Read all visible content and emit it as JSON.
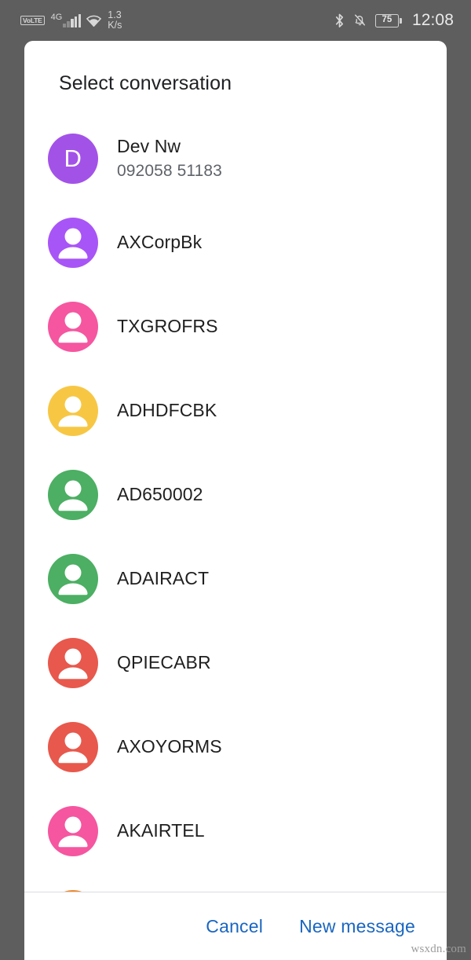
{
  "statusbar": {
    "volte_label": "VoLTE",
    "network_generation": "4G",
    "signal_icon": "signal-bars-icon",
    "wifi_icon": "wifi-icon",
    "net_speed_value": "1.3",
    "net_speed_unit": "K/s",
    "bluetooth_icon": "bluetooth-icon",
    "silent_icon": "bell-muted-icon",
    "battery_level": "75",
    "clock": "12:08"
  },
  "dialog": {
    "title": "Select conversation",
    "conversations": [
      {
        "name": "Dev Nw",
        "subtitle": "092058 51183",
        "avatar_kind": "letter",
        "avatar_letter": "D",
        "avatar_color": "#a352e8"
      },
      {
        "name": "AXCorpBk",
        "subtitle": "",
        "avatar_kind": "person",
        "avatar_letter": "",
        "avatar_color": "#a855f7"
      },
      {
        "name": "TXGROFRS",
        "subtitle": "",
        "avatar_kind": "person",
        "avatar_letter": "",
        "avatar_color": "#f5569f"
      },
      {
        "name": "ADHDFCBK",
        "subtitle": "",
        "avatar_kind": "person",
        "avatar_letter": "",
        "avatar_color": "#f7c744"
      },
      {
        "name": "AD650002",
        "subtitle": "",
        "avatar_kind": "person",
        "avatar_letter": "",
        "avatar_color": "#4caf63"
      },
      {
        "name": "ADAIRACT",
        "subtitle": "",
        "avatar_kind": "person",
        "avatar_letter": "",
        "avatar_color": "#4caf63"
      },
      {
        "name": "QPIECABR",
        "subtitle": "",
        "avatar_kind": "person",
        "avatar_letter": "",
        "avatar_color": "#e8584c"
      },
      {
        "name": "AXOYORMS",
        "subtitle": "",
        "avatar_kind": "person",
        "avatar_letter": "",
        "avatar_color": "#e8584c"
      },
      {
        "name": "AKAIRTEL",
        "subtitle": "",
        "avatar_kind": "person",
        "avatar_letter": "",
        "avatar_color": "#f5569f"
      },
      {
        "name": "",
        "subtitle": "",
        "avatar_kind": "person",
        "avatar_letter": "",
        "avatar_color": "#f0892e"
      }
    ],
    "cancel_label": "Cancel",
    "new_message_label": "New message"
  },
  "watermark": "wsxdn.com",
  "colors": {
    "scrim": "#5e5e5e",
    "card": "#ffffff",
    "accent": "#1a66c0",
    "title_text": "#202124",
    "subtitle_text": "#5f6368",
    "divider": "#dadce0"
  }
}
